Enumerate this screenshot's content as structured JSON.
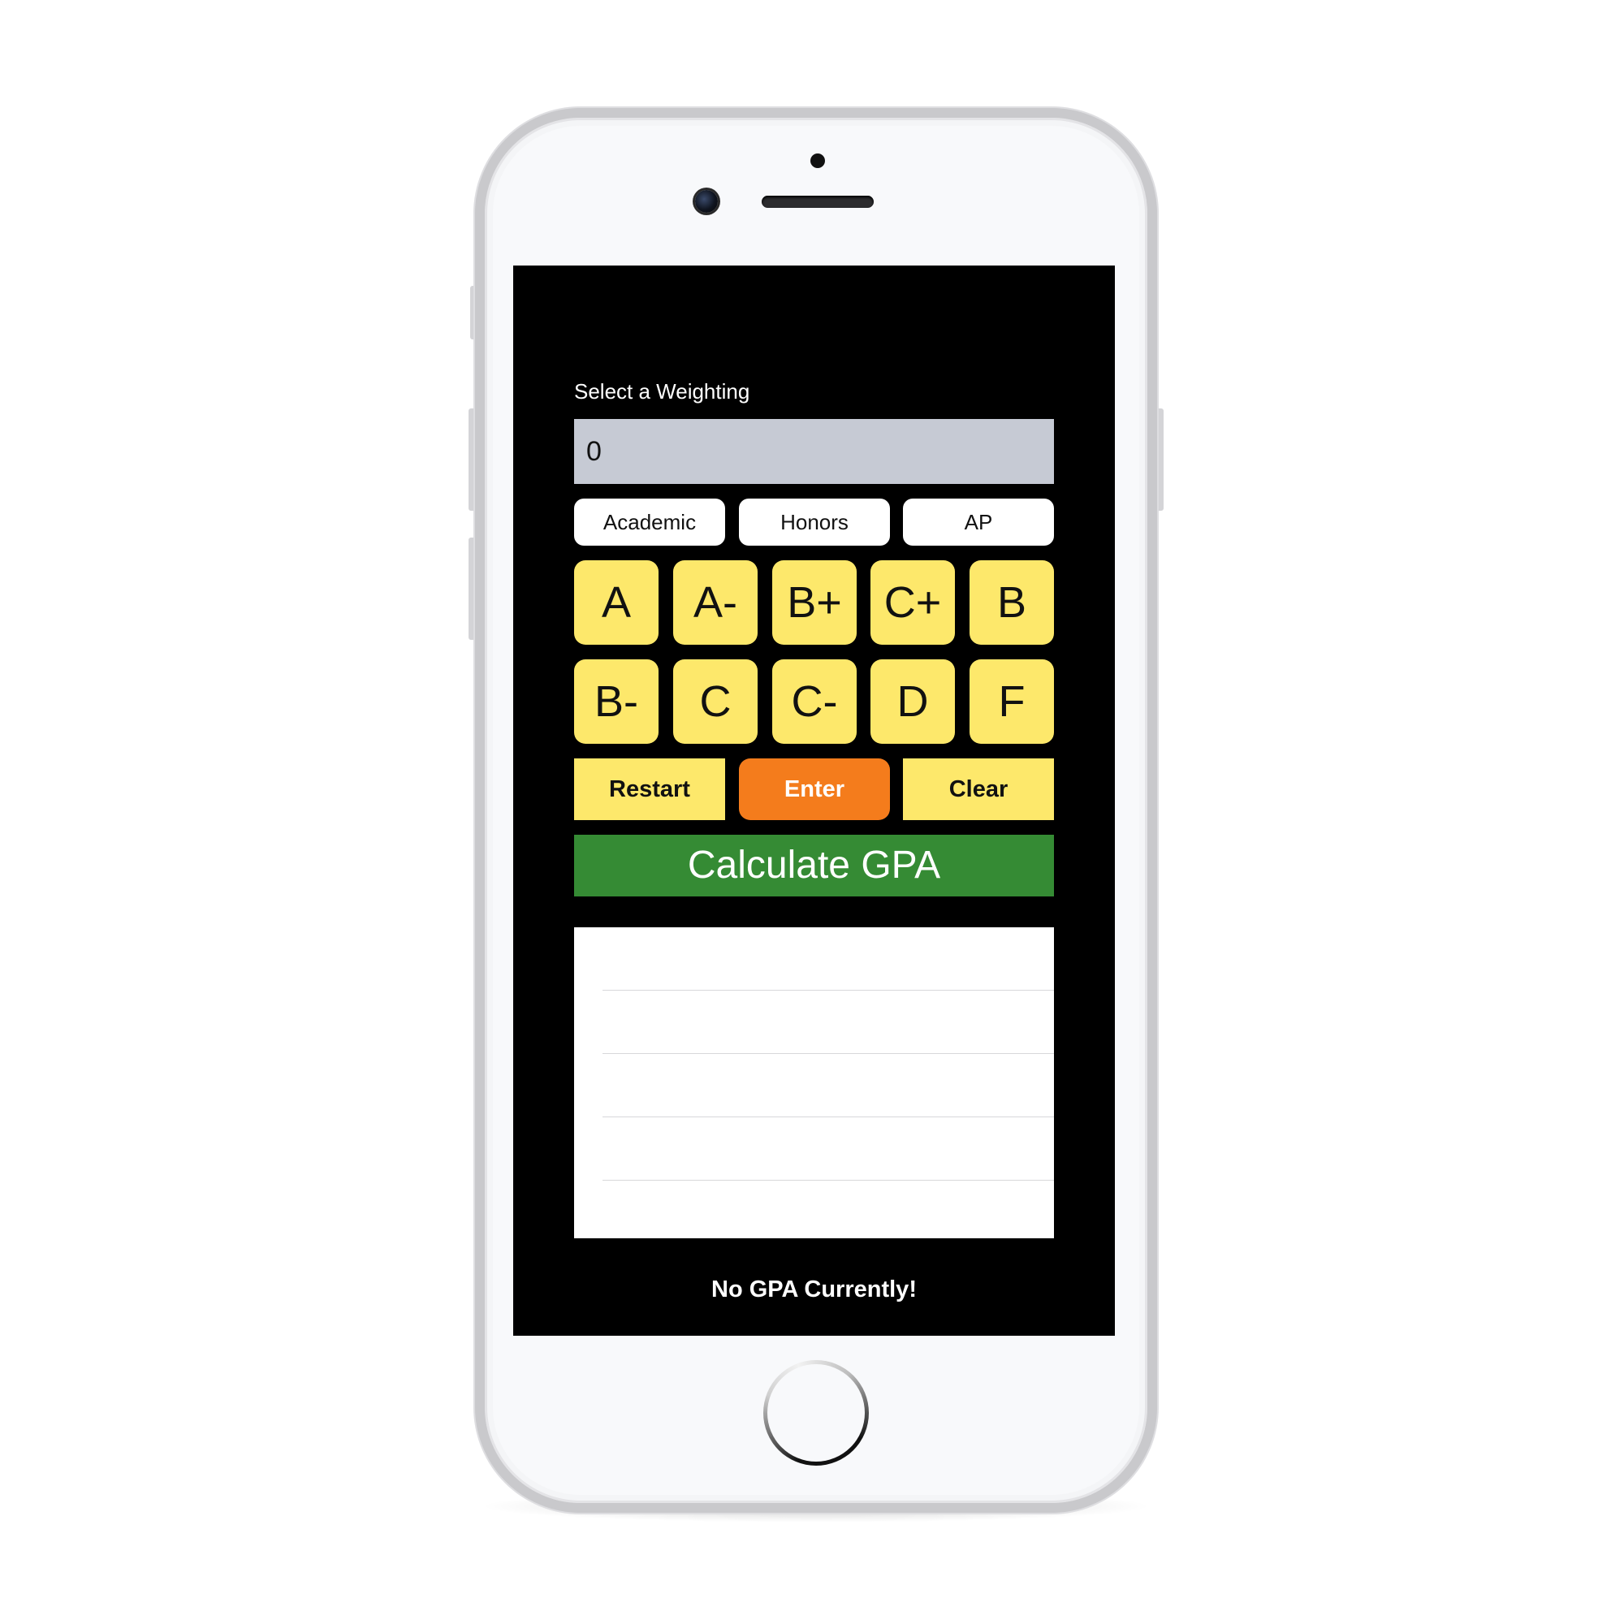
{
  "weighting": {
    "label": "Select a Weighting",
    "value": "0"
  },
  "weight_options": [
    "Academic",
    "Honors",
    "AP"
  ],
  "grades": {
    "row1": [
      "A",
      "A-",
      "B+",
      "C+",
      "B"
    ],
    "row2": [
      "B-",
      "C",
      "C-",
      "D",
      "F"
    ]
  },
  "actions": {
    "restart": "Restart",
    "enter": "Enter",
    "clear": "Clear"
  },
  "calculate_label": "Calculate GPA",
  "status_text": "No GPA Currently!",
  "colors": {
    "grade_button": "#fde86b",
    "enter_button": "#f47c1c",
    "calculate_button": "#358b34",
    "weight_field": "#c6cad4",
    "screen_background": "#000000"
  }
}
